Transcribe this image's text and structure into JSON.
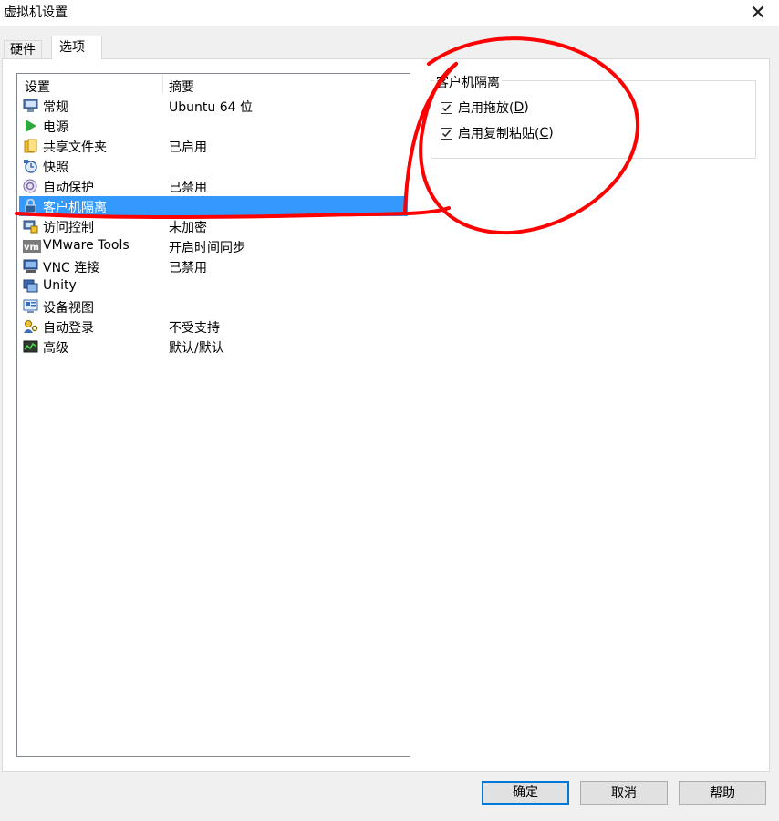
{
  "window": {
    "title": "虚拟机设置"
  },
  "tabs": [
    {
      "label": "硬件"
    },
    {
      "label": "选项"
    }
  ],
  "list": {
    "headers": {
      "setting": "设置",
      "summary": "摘要"
    },
    "rows": [
      {
        "name": "常规",
        "summary": "Ubuntu 64 位",
        "icon": "monitor-icon"
      },
      {
        "name": "电源",
        "summary": "",
        "icon": "play-icon"
      },
      {
        "name": "共享文件夹",
        "summary": "已启用",
        "icon": "folder-icon"
      },
      {
        "name": "快照",
        "summary": "",
        "icon": "snapshot-icon"
      },
      {
        "name": "自动保护",
        "summary": "已禁用",
        "icon": "autoprotect-icon"
      },
      {
        "name": "客户机隔离",
        "summary": "",
        "icon": "lock-icon",
        "selected": true
      },
      {
        "name": "访问控制",
        "summary": "未加密",
        "icon": "access-control-icon"
      },
      {
        "name": "VMware Tools",
        "summary": "开启时间同步",
        "icon": "vmware-icon"
      },
      {
        "name": "VNC 连接",
        "summary": "已禁用",
        "icon": "vnc-icon"
      },
      {
        "name": "Unity",
        "summary": "",
        "icon": "unity-icon"
      },
      {
        "name": "设备视图",
        "summary": "",
        "icon": "device-view-icon"
      },
      {
        "name": "自动登录",
        "summary": "不受支持",
        "icon": "user-key-icon"
      },
      {
        "name": "高级",
        "summary": "默认/默认",
        "icon": "chart-icon"
      }
    ]
  },
  "isolation": {
    "group_label": "客户机隔离",
    "drag_drop": {
      "label": "启用拖放(",
      "key": "D",
      "suffix": ")",
      "checked": true
    },
    "copy_paste": {
      "label": "启用复制粘贴(",
      "key": "C",
      "suffix": ")",
      "checked": true
    }
  },
  "buttons": {
    "ok": "确定",
    "cancel": "取消",
    "help": "帮助"
  },
  "colors": {
    "selection": "#3399ff",
    "annotation": "#ff0000",
    "default_button_border": "#0078d7"
  }
}
